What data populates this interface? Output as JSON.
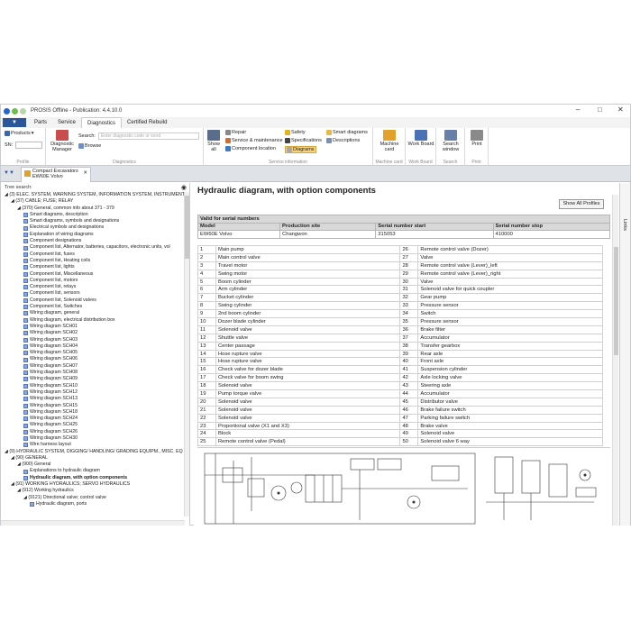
{
  "window": {
    "title": "PROSIS Offline - Publication: 4.4.10.0",
    "controls": [
      "–",
      "□",
      "✕"
    ]
  },
  "menu": {
    "file": "",
    "tabs": [
      "Parts",
      "Service",
      "Diagnostics",
      "Certified Rebuild"
    ],
    "active": "Diagnostics"
  },
  "ribbon": {
    "products": "Products",
    "sn": "SN:",
    "profile": "Profile",
    "diag_manager": "Diagnostic Manager",
    "search_label": "Search:",
    "search_placeholder": "Enter diagnostic code or word",
    "browse": "Browse",
    "diagnostics": "Diagnostics",
    "show_all": "Show all",
    "repair": "Repair",
    "svc_maint": "Service & maintenance",
    "component_location": "Component location",
    "safety": "Safety",
    "specifications": "Specifications",
    "diagrams": "Diagrams",
    "smart_diagrams": "Smart diagrams",
    "descriptions": "Descriptions",
    "service_info": "Service information",
    "machine_card": "Machine card",
    "work_board": "Work Board",
    "search_window": "Search window",
    "print": "Print",
    "g_machine_card": "Machine card",
    "g_work_board": "Work Board",
    "g_search": "Search",
    "g_print": "Print"
  },
  "doctab": {
    "line1": "Compact Excavators",
    "line2": "EW60E Volvo",
    "close": "✕"
  },
  "tree": {
    "header": "Tree search:",
    "items": [
      {
        "t": "◢ (3) ELEC. SYSTEM, WARNING SYSTEM, INFORMATION  SYSTEM, INSTRUMENTS",
        "i": 0,
        "sq": false
      },
      {
        "t": "◢ (37) CABLE; FUSE; RELAY",
        "i": 1,
        "sq": false
      },
      {
        "t": "◢ (370) General, common info about 371 - 379",
        "i": 2,
        "sq": false
      },
      {
        "t": "Smart diagrams, description",
        "i": 3,
        "sq": true
      },
      {
        "t": "Smart diagrams, symbols and designations",
        "i": 3,
        "sq": true
      },
      {
        "t": "Electrical symbols and designations",
        "i": 3,
        "sq": true
      },
      {
        "t": "Explanation of wiring diagrams",
        "i": 3,
        "sq": true
      },
      {
        "t": "Component designations",
        "i": 3,
        "sq": true
      },
      {
        "t": "Component list, Alternator, batteries, capacitors, electronic units, vol",
        "i": 3,
        "sq": true
      },
      {
        "t": "Component list, fuses",
        "i": 3,
        "sq": true
      },
      {
        "t": "Component list, Heating coils",
        "i": 3,
        "sq": true
      },
      {
        "t": "Component list, lights",
        "i": 3,
        "sq": true
      },
      {
        "t": "Component list, Miscellaneous",
        "i": 3,
        "sq": true
      },
      {
        "t": "Component list, motors",
        "i": 3,
        "sq": true
      },
      {
        "t": "Component list, relays",
        "i": 3,
        "sq": true
      },
      {
        "t": "Component list, sensors",
        "i": 3,
        "sq": true
      },
      {
        "t": "Component list, Solenoid valves",
        "i": 3,
        "sq": true
      },
      {
        "t": "Component list, Switches",
        "i": 3,
        "sq": true
      },
      {
        "t": "Wiring diagram, general",
        "i": 3,
        "sq": true
      },
      {
        "t": "Wiring diagram, electrical distribution box",
        "i": 3,
        "sq": true
      },
      {
        "t": "Wiring diagram SCH01",
        "i": 3,
        "sq": true
      },
      {
        "t": "Wiring diagram SCH02",
        "i": 3,
        "sq": true
      },
      {
        "t": "Wiring diagram SCH03",
        "i": 3,
        "sq": true
      },
      {
        "t": "Wiring diagram SCH04",
        "i": 3,
        "sq": true
      },
      {
        "t": "Wiring diagram SCH05",
        "i": 3,
        "sq": true
      },
      {
        "t": "Wiring diagram SCH06",
        "i": 3,
        "sq": true
      },
      {
        "t": "Wiring diagram SCH07",
        "i": 3,
        "sq": true
      },
      {
        "t": "Wiring diagram SCH08",
        "i": 3,
        "sq": true
      },
      {
        "t": "Wiring diagram SCH09",
        "i": 3,
        "sq": true
      },
      {
        "t": "Wiring diagram SCH10",
        "i": 3,
        "sq": true
      },
      {
        "t": "Wiring diagram SCH12",
        "i": 3,
        "sq": true
      },
      {
        "t": "Wiring diagram SCH13",
        "i": 3,
        "sq": true
      },
      {
        "t": "Wiring diagram SCH15",
        "i": 3,
        "sq": true
      },
      {
        "t": "Wiring diagram SCH18",
        "i": 3,
        "sq": true
      },
      {
        "t": "Wiring diagram SCH24",
        "i": 3,
        "sq": true
      },
      {
        "t": "Wiring diagram SCH25",
        "i": 3,
        "sq": true
      },
      {
        "t": "Wiring diagram SCH26",
        "i": 3,
        "sq": true
      },
      {
        "t": "Wiring diagram SCH30",
        "i": 3,
        "sq": true
      },
      {
        "t": "Wire harness layout",
        "i": 3,
        "sq": true
      },
      {
        "t": "◢ (9) HYDRAULIC SYSTEM, DIGGING/ HANDLING/  GRADING EQUIPM., MISC. EQ",
        "i": 0,
        "sq": false
      },
      {
        "t": "◢ (90) GENERAL",
        "i": 1,
        "sq": false
      },
      {
        "t": "◢ (900) General",
        "i": 2,
        "sq": false
      },
      {
        "t": "Explanations to hydraulic diagram",
        "i": 3,
        "sq": true
      },
      {
        "t": "Hydraulic diagram, with option components",
        "i": 3,
        "sq": true,
        "sel": true
      },
      {
        "t": "◢ (91) WORKING HYDRAULICS; SERVO  HYDRAULICS",
        "i": 1,
        "sq": false
      },
      {
        "t": "◢ (912) Working hydraulics",
        "i": 2,
        "sq": false
      },
      {
        "t": "◢ (9121) Directional valve; control valve",
        "i": 3,
        "sq": false
      },
      {
        "t": "Hydraulic diagram, ports",
        "i": 4,
        "sq": true
      }
    ]
  },
  "content": {
    "title": "Hydraulic diagram, with option components",
    "show_profiles": "Show All Profiles",
    "valid_for": "Valid for serial numbers",
    "serial_headers": [
      "Model",
      "Production site",
      "Serial number start",
      "Serial number stop"
    ],
    "serial_row": [
      "EW60E Volvo",
      "Changwon",
      "315053",
      "410000"
    ],
    "parts": [
      [
        "1",
        "Main pump",
        "26",
        "Remote control valve (Dozer)"
      ],
      [
        "2",
        "Main control valve",
        "27",
        "Valve"
      ],
      [
        "3",
        "Travel motor",
        "28",
        "Remote control valve (Lever)_left"
      ],
      [
        "4",
        "Swing motor",
        "29",
        "Remote control valve (Lever)_right"
      ],
      [
        "5",
        "Boom cylinder",
        "30",
        "Valve"
      ],
      [
        "6",
        "Arm cylinder",
        "31",
        "Solenoid valve for quick coupler"
      ],
      [
        "7",
        "Bucket cylinder",
        "32",
        "Gear pump"
      ],
      [
        "8",
        "Swing cylinder",
        "33",
        "Pressure sensor"
      ],
      [
        "9",
        "2nd boom cylinder",
        "34",
        "Switch"
      ],
      [
        "10",
        "Dozer blade cylinder",
        "35",
        "Pressure sensor"
      ],
      [
        "11",
        "Solenoid valve",
        "36",
        "Brake filter"
      ],
      [
        "12",
        "Shuttle valve",
        "37",
        "Accumulator"
      ],
      [
        "13",
        "Center passage",
        "38",
        "Transfer gearbox"
      ],
      [
        "14",
        "Hose rupture valve",
        "39",
        "Rear axle"
      ],
      [
        "15",
        "Hose rupture valve",
        "40",
        "Front axle"
      ],
      [
        "16",
        "Check valve for dozer blade",
        "41",
        "Suspension cylinder"
      ],
      [
        "17",
        "Check valve for boom swing",
        "42",
        "Axle locking valve"
      ],
      [
        "18",
        "Solenoid valve",
        "43",
        "Steering axle"
      ],
      [
        "19",
        "Pump torque valve",
        "44",
        "Accumulator"
      ],
      [
        "20",
        "Solenoid valve",
        "45",
        "Distributor valve"
      ],
      [
        "21",
        "Solenoid valve",
        "46",
        "Brake failure switch"
      ],
      [
        "22",
        "Solenoid valve",
        "47",
        "Parking failure switch"
      ],
      [
        "23",
        "Proportional valve (X1 and X3)",
        "48",
        "Brake valve"
      ],
      [
        "24",
        "Block",
        "49",
        "Solenoid valve"
      ],
      [
        "25",
        "Remote control valve (Pedal)",
        "50",
        "Solenoid valve 6 way"
      ]
    ]
  },
  "rightbar": {
    "links": "Links"
  }
}
